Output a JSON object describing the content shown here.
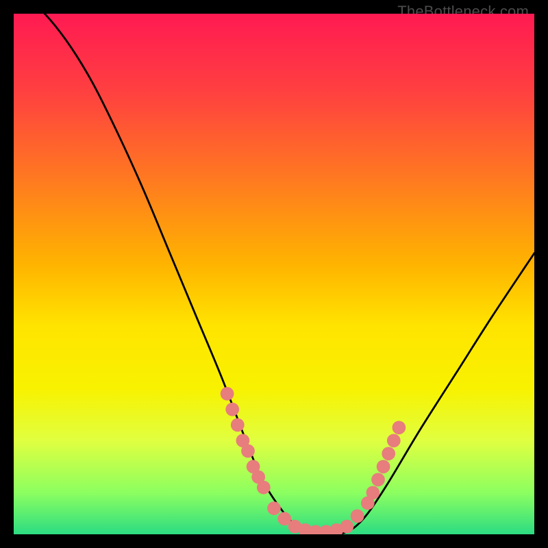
{
  "watermark": "TheBottleneck.com",
  "chart_data": {
    "type": "line",
    "title": "",
    "xlabel": "",
    "ylabel": "",
    "xlim": [
      0,
      100
    ],
    "ylim": [
      0,
      100
    ],
    "grid": false,
    "legend": false,
    "series": [
      {
        "name": "bottleneck-curve",
        "x": [
          0,
          5,
          10,
          15,
          20,
          25,
          30,
          35,
          40,
          45,
          48,
          52,
          55,
          58,
          62,
          65,
          68,
          72,
          78,
          85,
          92,
          100
        ],
        "y": [
          105,
          101,
          95,
          87,
          77,
          66,
          54,
          42,
          30,
          17,
          10,
          4,
          1,
          0,
          0,
          1,
          4,
          10,
          20,
          31,
          42,
          54
        ],
        "color": "#000000"
      }
    ],
    "markers": {
      "name": "highlight-dots",
      "color": "#e77d7d",
      "radius": 1.3,
      "points_xy": [
        [
          41,
          27
        ],
        [
          42,
          24
        ],
        [
          43,
          21
        ],
        [
          44,
          18
        ],
        [
          45,
          16
        ],
        [
          46,
          13
        ],
        [
          47,
          11
        ],
        [
          48,
          9
        ],
        [
          50,
          5
        ],
        [
          52,
          3
        ],
        [
          54,
          1.5
        ],
        [
          56,
          0.8
        ],
        [
          58,
          0.5
        ],
        [
          60,
          0.5
        ],
        [
          62,
          0.8
        ],
        [
          64,
          1.5
        ],
        [
          66,
          3.5
        ],
        [
          68,
          6
        ],
        [
          69,
          8
        ],
        [
          70,
          10.5
        ],
        [
          71,
          13
        ],
        [
          72,
          15.5
        ],
        [
          73,
          18
        ],
        [
          74,
          20.5
        ]
      ]
    },
    "annotations": [
      {
        "text": "TheBottleneck.com",
        "position": "top-right"
      }
    ]
  }
}
